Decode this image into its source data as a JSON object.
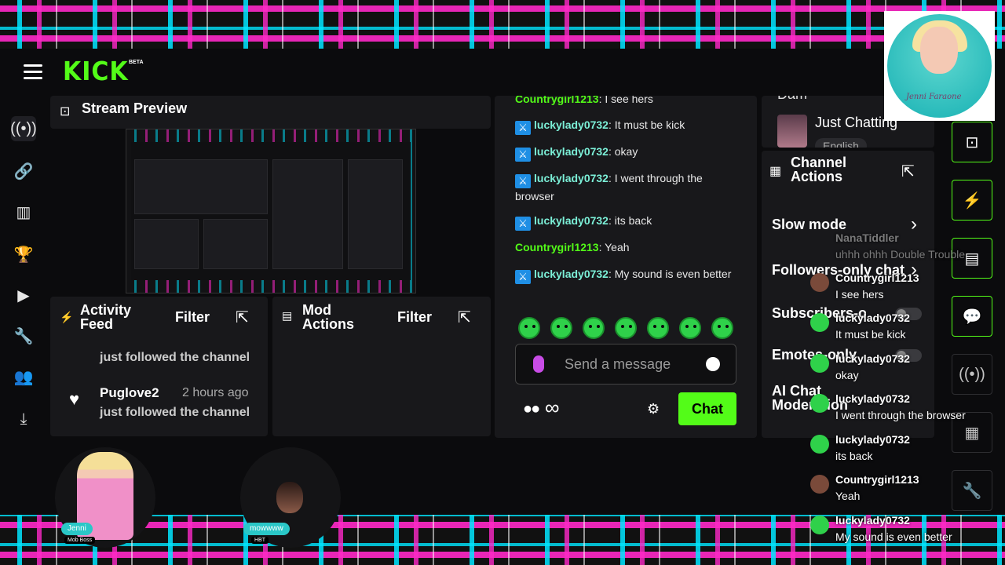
{
  "brand": {
    "logo": "KICK",
    "beta": "BETA"
  },
  "nav_icons": [
    "live-icon",
    "link-icon",
    "analytics-icon",
    "trophy-icon",
    "video-icon",
    "wrench-icon",
    "users-icon",
    "download-icon"
  ],
  "preview": {
    "title": "Stream Preview"
  },
  "activity": {
    "title": "Activity Feed",
    "filter": "Filter",
    "items": [
      {
        "name": "",
        "time": "",
        "text": "just followed the channel"
      },
      {
        "name": "Puglove2",
        "time": "2 hours ago",
        "text": "just followed the channel"
      }
    ]
  },
  "mod": {
    "title": "Mod Actions",
    "filter": "Filter"
  },
  "chat": {
    "messages": [
      {
        "user": "Countrygirl1213",
        "text": ": I see hers",
        "badge": false
      },
      {
        "user": "luckylady0732",
        "text": ": It must be kick",
        "badge": true
      },
      {
        "user": "luckylady0732",
        "text": ": okay",
        "badge": true
      },
      {
        "user": "luckylady0732",
        "text": ": I went through the browser",
        "badge": true
      },
      {
        "user": "luckylady0732",
        "text": ": its back",
        "badge": true
      },
      {
        "user": "Countrygirl1213",
        "text": ": Yeah",
        "badge": false
      },
      {
        "user": "luckylady0732",
        "text": ": My sound is even better",
        "badge": true
      }
    ],
    "input_placeholder": "Send a message",
    "send_label": "Chat"
  },
  "stream_info": {
    "partial_title": "Dam",
    "category": "Just Chatting",
    "language": "English"
  },
  "channel_actions": {
    "title": "Channel Actions",
    "rows": [
      "Slow mode",
      "Followers-only chat",
      "Subscribers-only",
      "Emotes-only",
      "AI Chat Moderation"
    ]
  },
  "overlay": {
    "signature": "Jenni Faraone",
    "chat": [
      {
        "user": "NanaTiddler",
        "text": "uhhh ohhh Double Trouble"
      },
      {
        "user": "Countrygirl1213",
        "text": "I see hers"
      },
      {
        "user": "luckylady0732",
        "text": "It must be kick"
      },
      {
        "user": "luckylady0732",
        "text": "okay"
      },
      {
        "user": "luckylady0732",
        "text": "I went through the browser"
      },
      {
        "user": "luckylady0732",
        "text": "its back"
      },
      {
        "user": "Countrygirl1213",
        "text": "Yeah"
      },
      {
        "user": "luckylady0732",
        "text": "My sound is even better"
      }
    ]
  },
  "cams": [
    {
      "label": "Jenni",
      "sub": "Mob Boss"
    },
    {
      "label": "mowwww",
      "sub": "HBT"
    }
  ],
  "colors": {
    "kick_green": "#53fc18",
    "panel": "#18181b",
    "bg": "#0b0b0d",
    "badge_blue": "#1f8fe5"
  }
}
